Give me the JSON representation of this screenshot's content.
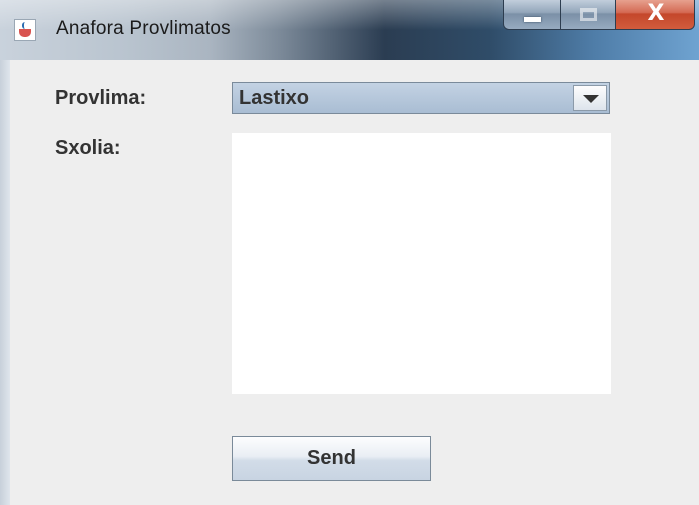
{
  "window": {
    "title": "Anafora Provlimatos",
    "app_icon": "java-cup-icon",
    "controls": {
      "minimize_icon": "minimize-icon",
      "maximize_icon": "maximize-icon",
      "close_label": "X"
    }
  },
  "form": {
    "problem_label": "Provlima:",
    "problem_selected": "Lastixo",
    "comments_label": "Sxolia:",
    "comments_value": "",
    "send_label": "Send"
  },
  "colors": {
    "panel_background": "#eeeeee",
    "combo_background": "#a9bdd3",
    "textarea_background": "#ffffff"
  }
}
